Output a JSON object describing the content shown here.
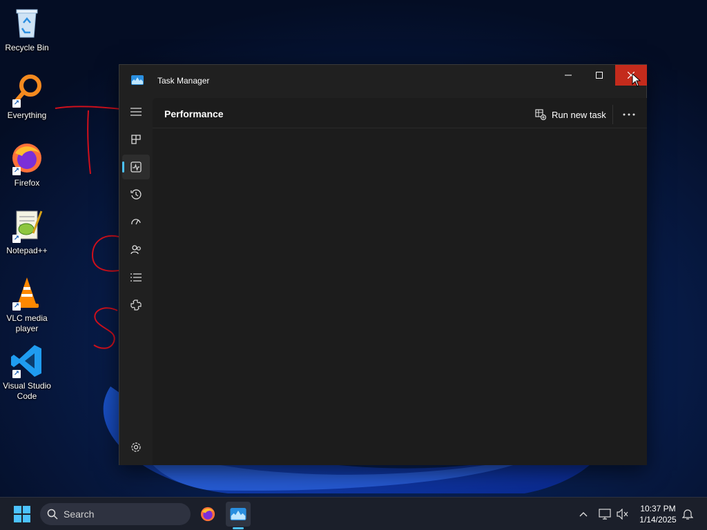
{
  "desktop": {
    "icons": [
      {
        "label": "Recycle Bin",
        "icon": "recycle-bin-icon",
        "shortcut": false
      },
      {
        "label": "Everything",
        "icon": "everything-search-icon",
        "shortcut": true
      },
      {
        "label": "Firefox",
        "icon": "firefox-icon",
        "shortcut": true
      },
      {
        "label": "Notepad++",
        "icon": "notepadpp-icon",
        "shortcut": true
      },
      {
        "label": "VLC media player",
        "icon": "vlc-cone-icon",
        "shortcut": true
      },
      {
        "label": "Visual Studio Code",
        "icon": "vscode-icon",
        "shortcut": true
      }
    ]
  },
  "window": {
    "title": "Task Manager",
    "page_title": "Performance",
    "run_new_task_label": "Run new task",
    "nav": [
      {
        "icon": "hamburger-menu-icon"
      },
      {
        "icon": "processes-icon"
      },
      {
        "icon": "performance-icon",
        "active": true
      },
      {
        "icon": "app-history-icon"
      },
      {
        "icon": "startup-apps-icon"
      },
      {
        "icon": "users-icon"
      },
      {
        "icon": "details-icon"
      },
      {
        "icon": "services-icon"
      },
      {
        "icon": "settings-icon"
      }
    ]
  },
  "taskbar": {
    "search_placeholder": "Search",
    "clock_time": "10:37 PM",
    "clock_date": "1/14/2025"
  },
  "colors": {
    "accent": "#4cc2ff",
    "close_hover": "#c42b1c",
    "window_bg": "#202020",
    "annotation": "#d0101c"
  }
}
